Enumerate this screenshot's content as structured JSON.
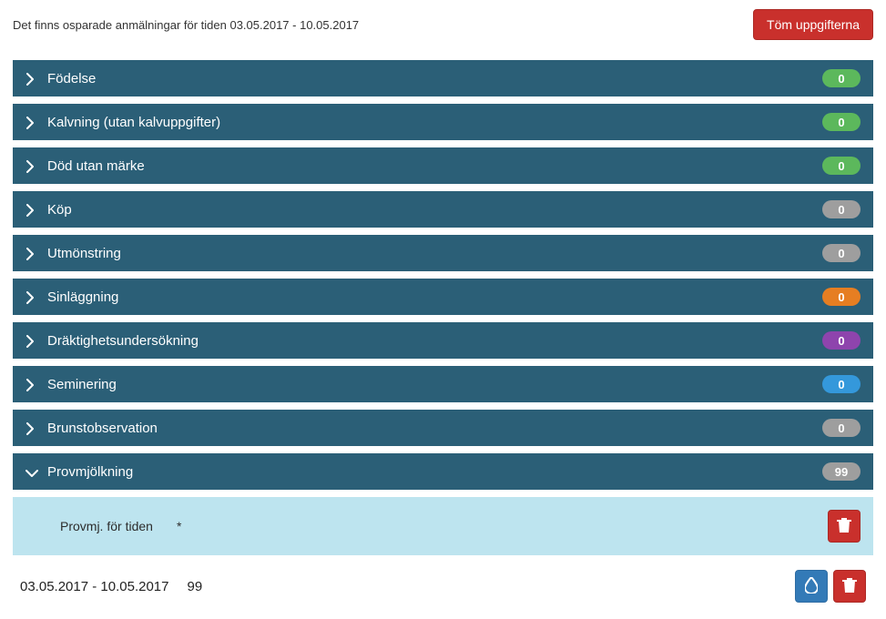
{
  "header": {
    "unsaved_message": "Det finns osparade anmälningar för tiden 03.05.2017 - 10.05.2017",
    "clear_button_label": "Töm uppgifterna"
  },
  "accordion": {
    "items": [
      {
        "label": "Födelse",
        "count": "0",
        "badge_color": "green",
        "expanded": false
      },
      {
        "label": "Kalvning (utan kalvuppgifter)",
        "count": "0",
        "badge_color": "green",
        "expanded": false
      },
      {
        "label": "Död utan märke",
        "count": "0",
        "badge_color": "green",
        "expanded": false
      },
      {
        "label": "Köp",
        "count": "0",
        "badge_color": "gray",
        "expanded": false
      },
      {
        "label": "Utmönstring",
        "count": "0",
        "badge_color": "gray",
        "expanded": false
      },
      {
        "label": "Sinläggning",
        "count": "0",
        "badge_color": "orange",
        "expanded": false
      },
      {
        "label": "Dräktighetsundersökning",
        "count": "0",
        "badge_color": "purple",
        "expanded": false
      },
      {
        "label": "Seminering",
        "count": "0",
        "badge_color": "blue",
        "expanded": false
      },
      {
        "label": "Brunstobservation",
        "count": "0",
        "badge_color": "gray",
        "expanded": false
      },
      {
        "label": "Provmjölkning",
        "count": "99",
        "badge_color": "gray",
        "expanded": true
      }
    ]
  },
  "expanded": {
    "field_label": "Provmj. för tiden",
    "required_mark": "*"
  },
  "bottom": {
    "date_range": "03.05.2017 - 10.05.2017",
    "value": "99"
  }
}
